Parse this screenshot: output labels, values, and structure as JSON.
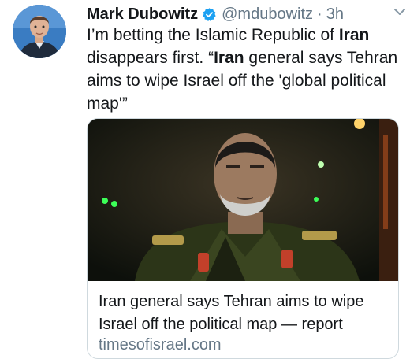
{
  "tweet": {
    "author_name": "Mark Dubowitz",
    "handle": "@mdubowitz",
    "separator": "·",
    "time": "3h",
    "text_segments": [
      {
        "text": "I’m betting the Islamic Republic of ",
        "bold": false
      },
      {
        "text": "Iran",
        "bold": true
      },
      {
        "text": " disappears first. “",
        "bold": false
      },
      {
        "text": "Iran",
        "bold": true
      },
      {
        "text": " general says Tehran aims to wipe Israel off the 'global political map'”",
        "bold": false
      }
    ]
  },
  "card": {
    "title": "Iran general says Tehran aims to wipe Israel off the political map — report",
    "domain": "timesofisrael.com"
  },
  "icons": {
    "verified": "verified-badge-icon",
    "caret": "chevron-down-icon"
  },
  "colors": {
    "verified_blue": "#1da1f2",
    "secondary_text": "#657786",
    "primary_text": "#14171a"
  }
}
